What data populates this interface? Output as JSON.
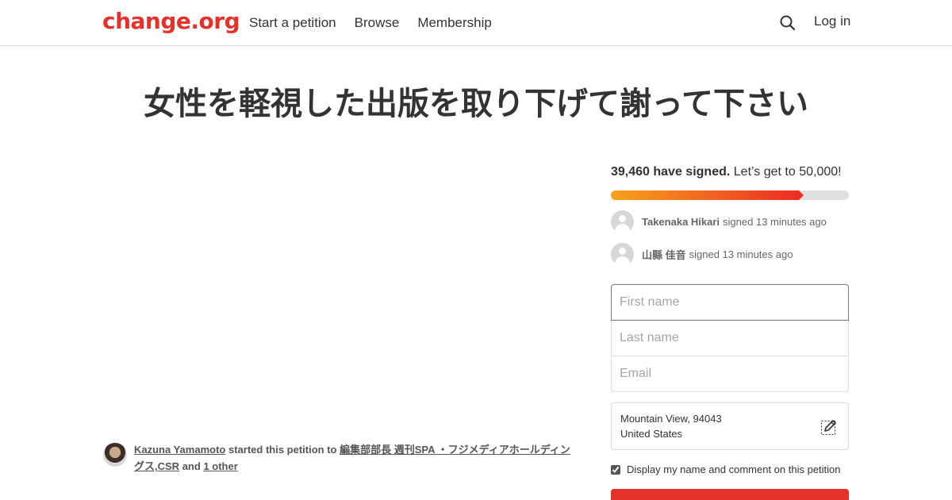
{
  "header": {
    "logo": "change.org",
    "nav": [
      "Start a petition",
      "Browse",
      "Membership"
    ],
    "search_icon": "search-icon",
    "login": "Log in",
    "brand_color": "#e4322b"
  },
  "petition": {
    "title": "女性を軽視した出版を取り下げて謝って下さい",
    "starter": {
      "name": "Kazuna Yamamoto",
      "started_text": "started this petition to",
      "target": "編集部部長 週刊SPA ・フジメディアホールディングス,CSR",
      "and_text": "and",
      "other": "1 other"
    }
  },
  "progress": {
    "count": "39,460 have signed.",
    "goal_text": "Let’s get to 50,000!",
    "signed": 39460,
    "goal": 50000
  },
  "recent_signers": [
    {
      "name": "Takenaka Hikari",
      "action": "signed 13 minutes ago"
    },
    {
      "name": "山縣 佳音",
      "action": "signed 13 minutes ago"
    }
  ],
  "form": {
    "first_name_placeholder": "First name",
    "last_name_placeholder": "Last name",
    "email_placeholder": "Email",
    "location_line1": "Mountain View, 94043",
    "location_line2": "United States",
    "edit_icon": "edit-icon",
    "display_checkbox_label": "Display my name and comment on this petition",
    "display_checked": true
  }
}
